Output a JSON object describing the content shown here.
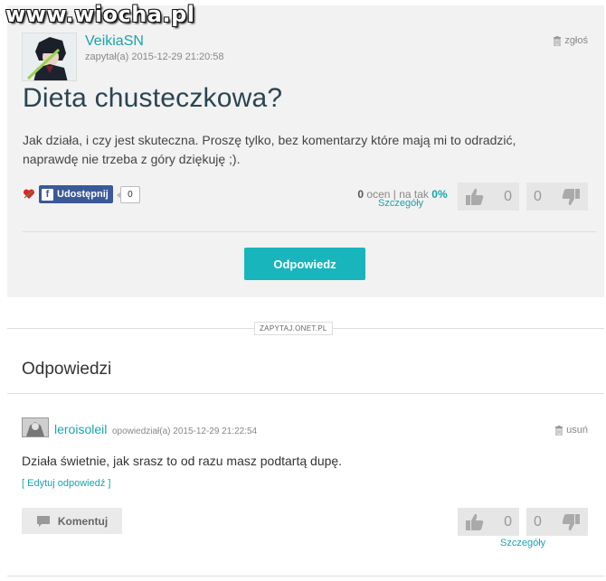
{
  "watermark": "www.wiocha.pl",
  "question": {
    "username": "VeikiaSN",
    "meta": "zapytał(a) 2015-12-29 21:20:58",
    "report_label": "zgłoś",
    "title": "Dieta chusteczkowa?",
    "text": "Jak działa, i czy jest skuteczna. Proszę tylko, bez komentarzy które mają mi to odradzić, naprawdę nie trzeba z góry dziękuję ;).",
    "share_label": "Udostępnij",
    "share_count": "0",
    "ratings_count": "0",
    "ratings_label": "ocen",
    "ratings_sep": "| na tak",
    "ratings_pct": "0%",
    "details_label": "Szczegóły",
    "vote_up": "0",
    "vote_down": "0",
    "answer_button": "Odpowiedz"
  },
  "source_tag": "ZAPYTAJ.ONET.PL",
  "answers_heading": "Odpowiedzi",
  "answer": {
    "username": "leroisoleil",
    "meta": "opowiedział(a) 2015-12-29 21:22:54",
    "delete_label": "usuń",
    "text": "Działa świetnie, jak srasz to od razu masz podtartą dupę.",
    "edit_label": "[ Edytuj odpowiedź ]",
    "comment_label": "Komentuj",
    "vote_up": "0",
    "vote_down": "0",
    "details_label": "Szczegóły"
  },
  "colors": {
    "accent": "#17a5b0",
    "button": "#18b5bd",
    "facebook": "#3b5998",
    "title": "#2b4552"
  }
}
